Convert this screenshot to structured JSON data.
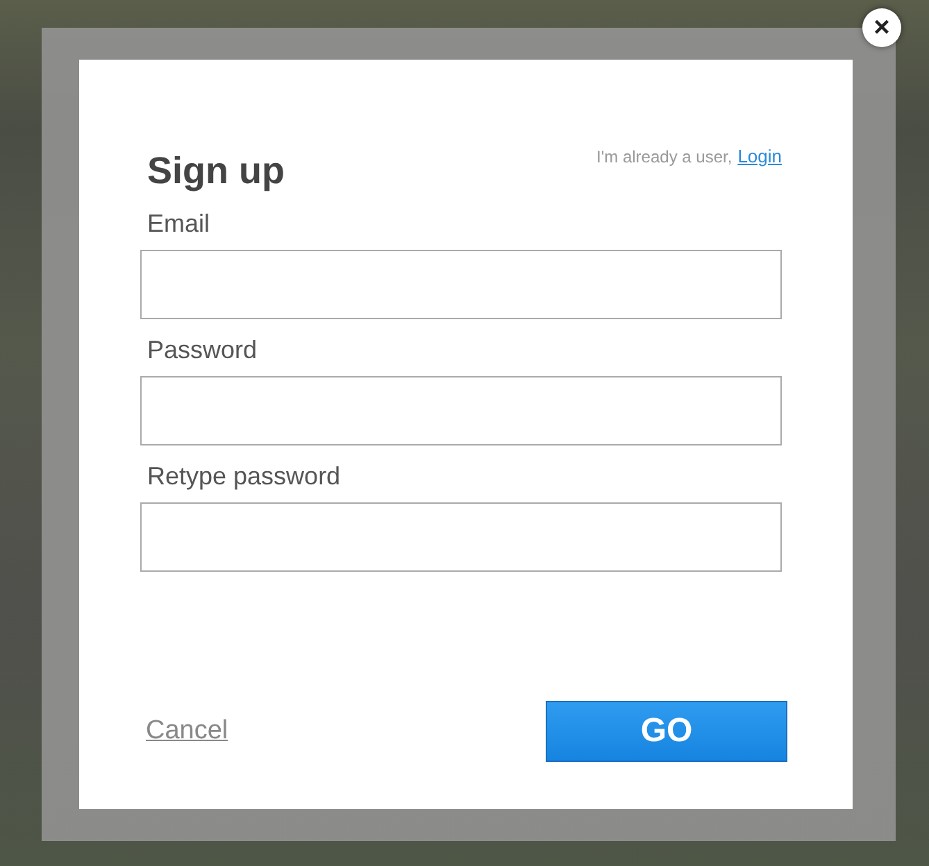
{
  "dialog": {
    "title": "Sign up",
    "login_prompt": "I'm already a user,",
    "login_link": "Login",
    "fields": [
      {
        "label": "Email"
      },
      {
        "label": "Password"
      },
      {
        "label": "Retype password"
      }
    ],
    "cancel": "Cancel",
    "submit": "GO",
    "close": "×"
  }
}
